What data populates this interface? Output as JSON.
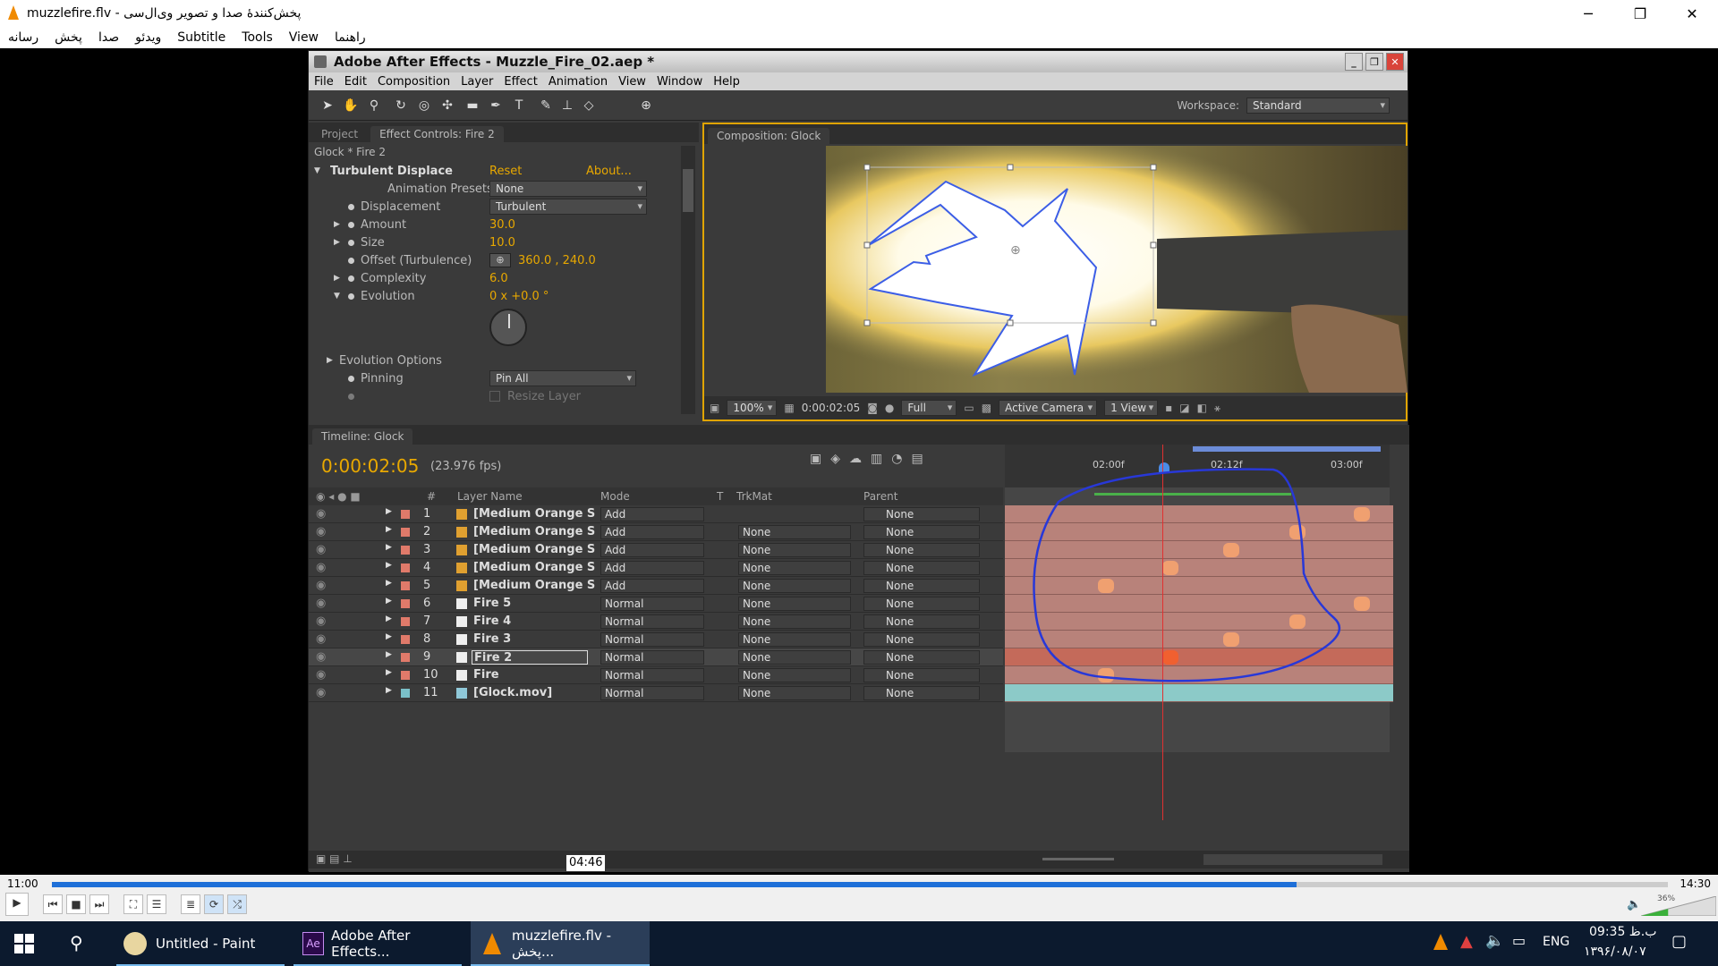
{
  "vlc": {
    "title": "muzzlefire.flv - پخش‌کنندهٔ صدا و تصویر وی‌ال‌سی",
    "menu": [
      "رسانه",
      "پخش",
      "صدا",
      "ویدئو",
      "Subtitle",
      "Tools",
      "View",
      "راهنما"
    ],
    "time_current": "11:00",
    "time_total": "14:30",
    "hover_time": "04:46",
    "progress": 0.77,
    "volume": "36%"
  },
  "ae": {
    "title": "Adobe After Effects - Muzzle_Fire_02.aep *",
    "menu": [
      "File",
      "Edit",
      "Composition",
      "Layer",
      "Effect",
      "Animation",
      "View",
      "Window",
      "Help"
    ],
    "workspace_label": "Workspace:",
    "workspace_value": "Standard",
    "effect_panel": {
      "tab_project": "Project",
      "tab_effect": "Effect Controls: Fire 2",
      "layer_path": "Glock * Fire 2",
      "effect_name": "Turbulent Displace",
      "reset": "Reset",
      "about": "About...",
      "rows": [
        {
          "label": "Animation Presets:",
          "value": "None"
        },
        {
          "label": "Displacement",
          "value": "Turbulent"
        },
        {
          "label": "Amount",
          "value": "30.0"
        },
        {
          "label": "Size",
          "value": "10.0"
        },
        {
          "label": "Offset (Turbulence)",
          "value": "360.0 , 240.0"
        },
        {
          "label": "Complexity",
          "value": "6.0"
        },
        {
          "label": "Evolution",
          "value": "0 x +0.0 °"
        },
        {
          "label": "Evolution Options",
          "value": ""
        },
        {
          "label": "Pinning",
          "value": "Pin All"
        },
        {
          "label": "",
          "value": "Resize Layer"
        }
      ]
    },
    "comp_panel": {
      "tab": "Composition: Glock",
      "zoom": "100%",
      "timecode": "0:00:02:05",
      "resolution": "Full",
      "camera": "Active Camera",
      "views": "1 View"
    },
    "timeline": {
      "tab": "Timeline: Glock",
      "timecode": "0:00:02:05",
      "fps": "(23.976 fps)",
      "ruler": [
        "02:00f",
        "02:12f",
        "03:00f"
      ],
      "headers": {
        "num": "#",
        "name": "Layer Name",
        "mode": "Mode",
        "t": "T",
        "trkmat": "TrkMat",
        "parent": "Parent"
      },
      "layers": [
        {
          "num": "1",
          "name": "[Medium Orange S",
          "mode": "Add",
          "trkmat": "",
          "parent": "None",
          "color": "#e0a030"
        },
        {
          "num": "2",
          "name": "[Medium Orange S",
          "mode": "Add",
          "trkmat": "None",
          "parent": "None",
          "color": "#e0a030"
        },
        {
          "num": "3",
          "name": "[Medium Orange S",
          "mode": "Add",
          "trkmat": "None",
          "parent": "None",
          "color": "#e0a030"
        },
        {
          "num": "4",
          "name": "[Medium Orange S",
          "mode": "Add",
          "trkmat": "None",
          "parent": "None",
          "color": "#e0a030"
        },
        {
          "num": "5",
          "name": "[Medium Orange S",
          "mode": "Add",
          "trkmat": "None",
          "parent": "None",
          "color": "#e0a030"
        },
        {
          "num": "6",
          "name": "Fire 5",
          "mode": "Normal",
          "trkmat": "None",
          "parent": "None",
          "color": "#eeeeee"
        },
        {
          "num": "7",
          "name": "Fire 4",
          "mode": "Normal",
          "trkmat": "None",
          "parent": "None",
          "color": "#eeeeee"
        },
        {
          "num": "8",
          "name": "Fire 3",
          "mode": "Normal",
          "trkmat": "None",
          "parent": "None",
          "color": "#eeeeee"
        },
        {
          "num": "9",
          "name": "Fire 2",
          "mode": "Normal",
          "trkmat": "None",
          "parent": "None",
          "color": "#eeeeee"
        },
        {
          "num": "10",
          "name": "Fire",
          "mode": "Normal",
          "trkmat": "None",
          "parent": "None",
          "color": "#eeeeee"
        },
        {
          "num": "11",
          "name": "[Glock.mov]",
          "mode": "Normal",
          "trkmat": "None",
          "parent": "None",
          "color": "#8fc8d8"
        }
      ]
    }
  },
  "taskbar": {
    "apps": [
      "Untitled - Paint",
      "Adobe After Effects...",
      "muzzlefire.flv - پخش..."
    ],
    "lang": "ENG",
    "time": "09:35 ب.ظ",
    "date": "۱۳۹۶/۰۸/۰۷"
  }
}
